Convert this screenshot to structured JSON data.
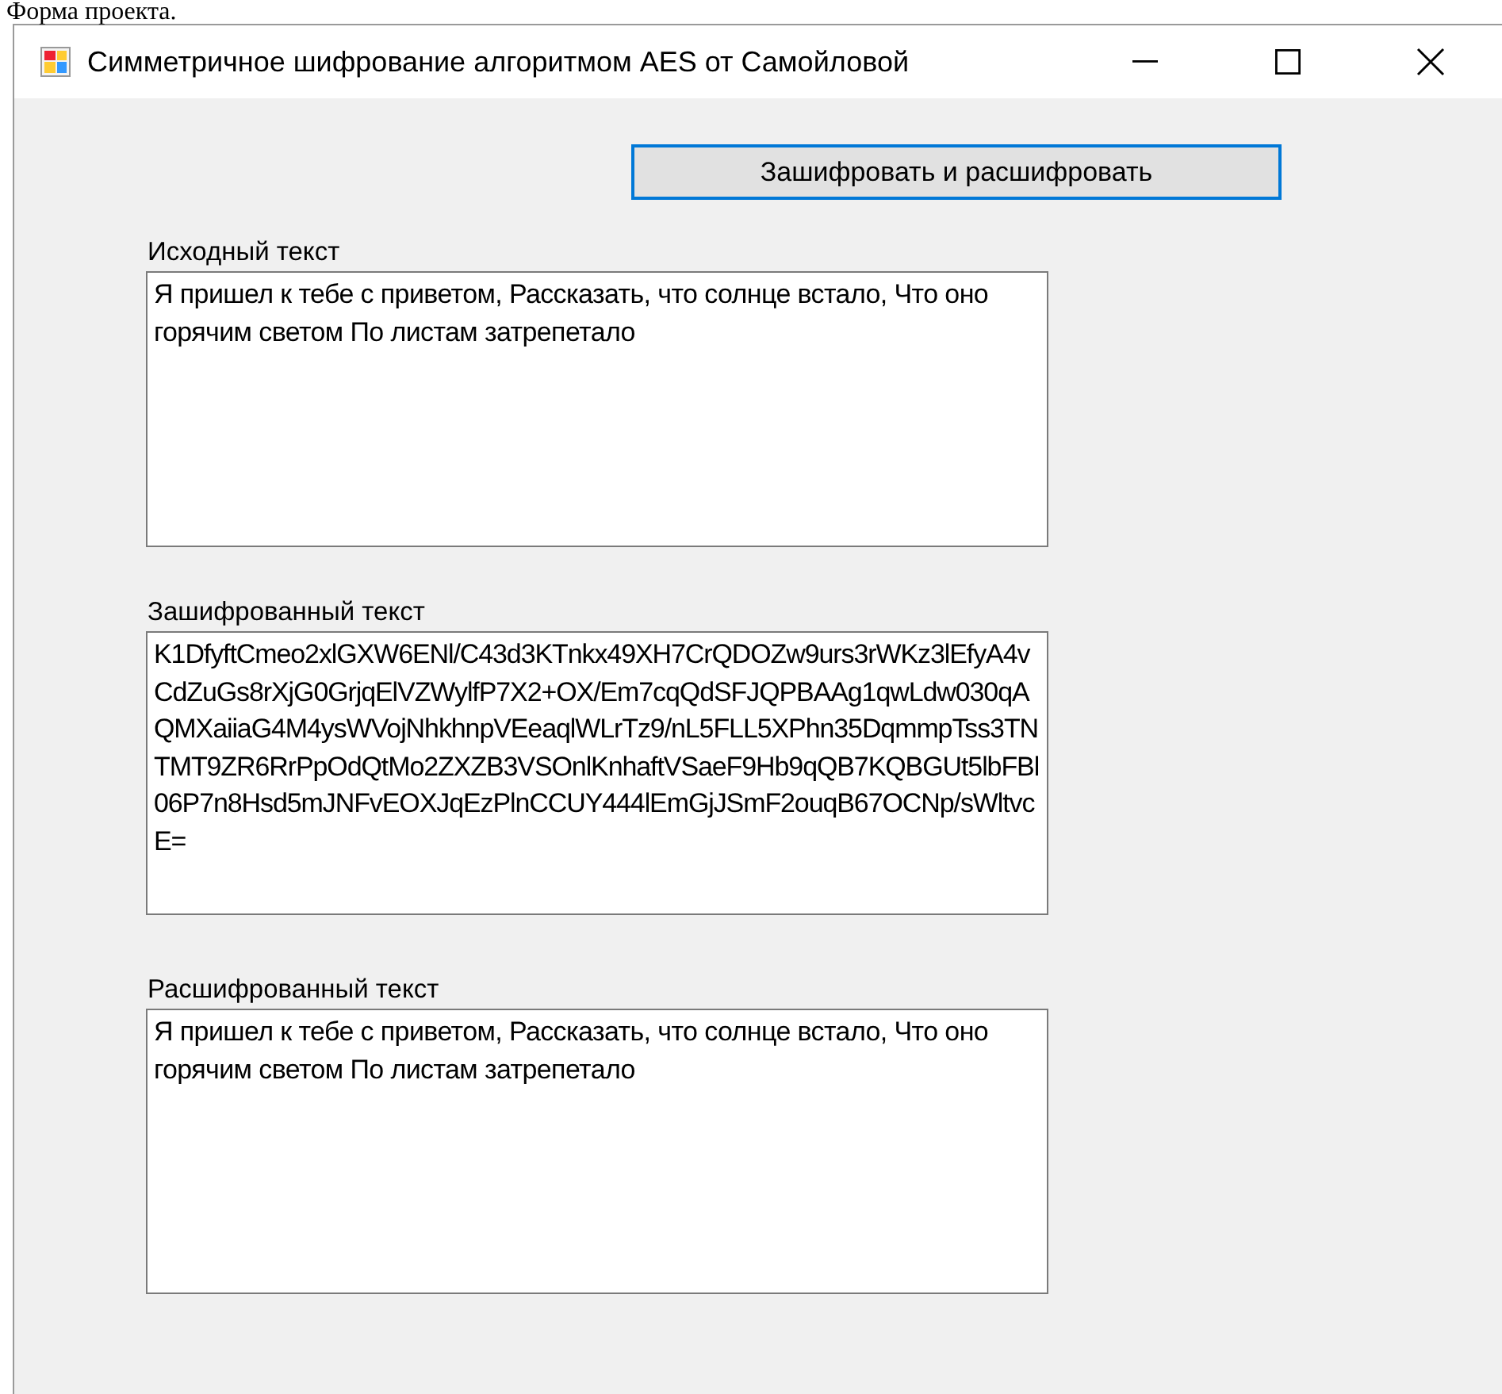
{
  "caption": "Форма проекта.",
  "window": {
    "title": "Симметричное шифрование алгоритмом AES от Самойловой"
  },
  "button": {
    "label": "Зашифровать и расшифровать"
  },
  "fields": [
    {
      "label": "Исходный текст",
      "value": "Я пришел к тебе с приветом, Рассказать, что солнце встало, Что оно  горячим светом По листам затрепетало"
    },
    {
      "label": "Зашифрованный текст",
      "value": "K1DfyftCmeo2xlGXW6ENl/C43d3KTnkx49XH7CrQDOZw9urs3rWKz3lEfyA4vCdZuGs8rXjG0GrjqElVZWylfP7X2+OX/Em7cqQdSFJQPBAAg1qwLdw030qAQMXaiiaG4M4ysWVojNhkhnpVEeaqlWLrTz9/nL5FLL5XPhn35DqmmpTss3TNTMT9ZR6RrPpOdQtMo2ZXZB3VSOnlKnhaftVSaeF9Hb9qQB7KQBGUt5lbFBl06P7n8Hsd5mJNFvEOXJqEzPlnCCUY444lEmGjJSmF2ouqB67OCNp/sWltvcE="
    },
    {
      "label": "Расшифрованный текст",
      "value": "Я пришел к тебе с приветом, Рассказать, что солнце встало, Что оно  горячим светом По листам затрепетало"
    }
  ]
}
